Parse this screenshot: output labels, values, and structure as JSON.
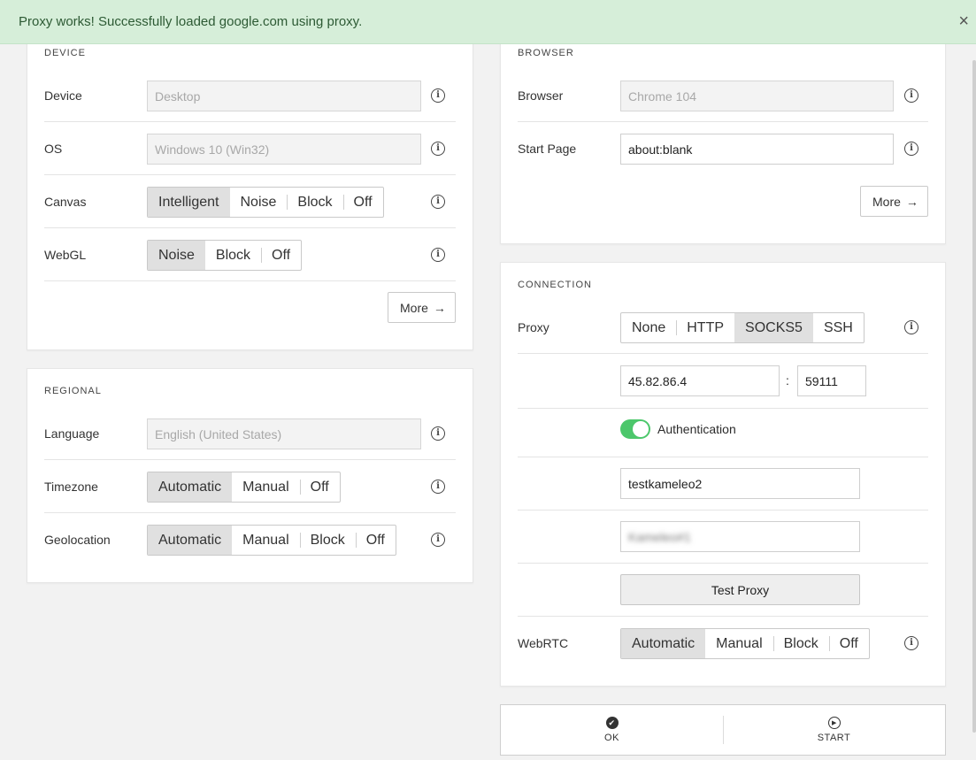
{
  "alert": {
    "message": "Proxy works! Successfully loaded google.com using proxy.",
    "close": "×"
  },
  "device": {
    "title": "DEVICE",
    "device_label": "Device",
    "device_value": "Desktop",
    "os_label": "OS",
    "os_value": "Windows 10 (Win32)",
    "canvas_label": "Canvas",
    "canvas_options": [
      "Intelligent",
      "Noise",
      "Block",
      "Off"
    ],
    "canvas_selected": "Intelligent",
    "webgl_label": "WebGL",
    "webgl_options": [
      "Noise",
      "Block",
      "Off"
    ],
    "webgl_selected": "Noise",
    "more_label": "More"
  },
  "regional": {
    "title": "REGIONAL",
    "language_label": "Language",
    "language_value": "English (United States)",
    "timezone_label": "Timezone",
    "timezone_options": [
      "Automatic",
      "Manual",
      "Off"
    ],
    "timezone_selected": "Automatic",
    "geolocation_label": "Geolocation",
    "geolocation_options": [
      "Automatic",
      "Manual",
      "Block",
      "Off"
    ],
    "geolocation_selected": "Automatic"
  },
  "browser": {
    "title": "BROWSER",
    "browser_label": "Browser",
    "browser_value": "Chrome 104",
    "start_page_label": "Start Page",
    "start_page_value": "about:blank",
    "more_label": "More"
  },
  "connection": {
    "title": "CONNECTION",
    "proxy_label": "Proxy",
    "proxy_options": [
      "None",
      "HTTP",
      "SOCKS5",
      "SSH"
    ],
    "proxy_selected": "SOCKS5",
    "host": "45.82.86.4",
    "colon": ":",
    "port": "59111",
    "auth_label": "Authentication",
    "auth_enabled": true,
    "username": "testkameleo2",
    "password": "Kameleo#1",
    "test_label": "Test Proxy",
    "webrtc_label": "WebRTC",
    "webrtc_options": [
      "Automatic",
      "Manual",
      "Block",
      "Off"
    ],
    "webrtc_selected": "Automatic"
  },
  "actions": {
    "ok_label": "OK",
    "start_label": "START"
  },
  "icons": {
    "info": "info-icon",
    "arrow": "→",
    "ok": "✔",
    "start": "▶"
  }
}
